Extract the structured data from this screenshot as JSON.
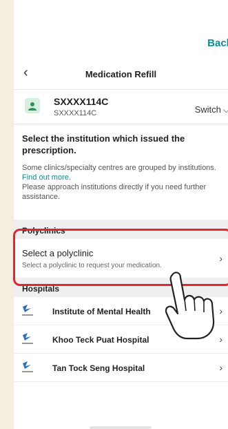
{
  "topbar": {
    "back_label": "Back"
  },
  "navbar": {
    "back_icon": "chevron-left-icon",
    "title": "Medication Refill"
  },
  "profile": {
    "avatar_icon": "person-icon",
    "id": "SXXXX114C",
    "id_sub": "SXXXX114C",
    "switch_label": "Switch"
  },
  "intro": {
    "title": "Select the institution which issued the prescription.",
    "body_1": "Some clinics/specialty centres are grouped by institutions.",
    "link": "Find out more.",
    "body_2": "Please approach institutions directly if you need further assistance."
  },
  "polyclinics": {
    "header": "Polyclinics",
    "row_title": "Select a polyclinic",
    "row_sub": "Select a polyclinic to request your medication."
  },
  "hospitals": {
    "header": "Hospitals",
    "items": [
      {
        "name": "Institute of Mental Health"
      },
      {
        "name": "Khoo Teck Puat Hospital"
      },
      {
        "name": "Tan Tock Seng Hospital"
      }
    ]
  },
  "colors": {
    "accent": "#0b8c9c",
    "highlight": "#e0262f",
    "section_bg": "#efefef"
  }
}
